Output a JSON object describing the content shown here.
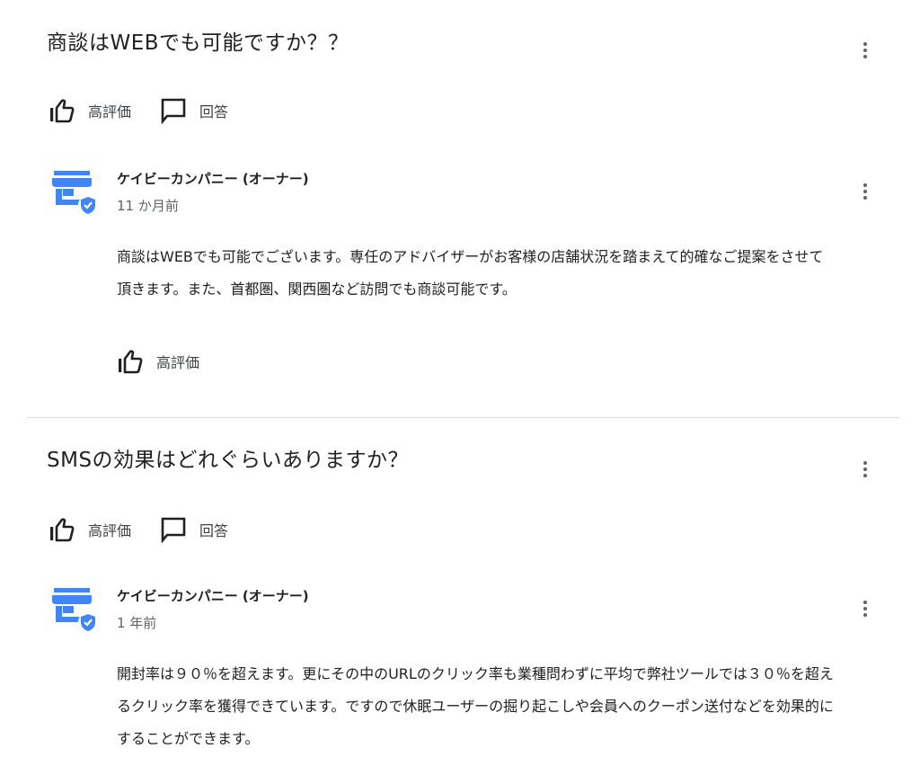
{
  "items": [
    {
      "question": "商談はWEBでも可能ですか？？",
      "like_label": "高評価",
      "answer_label": "回答",
      "answer": {
        "owner_name": "ケイビーカンパニー (オーナー)",
        "time": "11 か月前",
        "text": "商談はWEBでも可能でございます。専任のアドバイザーがお客様の店舗状況を踏まえて的確なご提案をさせて頂きます。また、首都圏、関西圏など訪問でも商談可能です。",
        "like_label": "高評価"
      }
    },
    {
      "question": "SMSの効果はどれぐらいありますか？",
      "like_label": "高評価",
      "answer_label": "回答",
      "answer": {
        "owner_name": "ケイビーカンパニー (オーナー)",
        "time": "1 年前",
        "text": "開封率は９０％を超えます。更にその中のURLのクリック率も業種問わずに平均で弊社ツールでは３０％を超えるクリック率を獲得できています。ですので休眠ユーザーの掘り起こしや会員へのクーポン送付などを効果的にすることができます。"
      }
    }
  ],
  "icons": {
    "more": "more-vert-icon",
    "like": "thumb-up-icon",
    "comment": "comment-icon",
    "avatar": "store-verified-icon"
  },
  "colors": {
    "avatar_blue": "#4285f4",
    "text": "#202124",
    "secondary_text": "#5f6368",
    "divider": "#dadce0"
  }
}
